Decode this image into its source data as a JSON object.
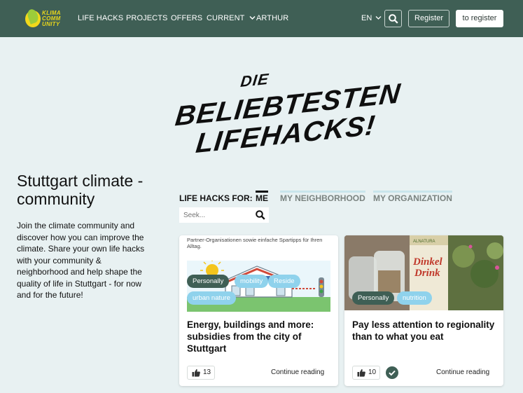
{
  "header": {
    "logo_text_line1": "KLIMA",
    "logo_text_line2": "COMM",
    "logo_text_line3": "UNITY",
    "nav": [
      "LIFE HACKS",
      "PROJECTS",
      "OFFERS",
      "CURRENT",
      "ARTHUR"
    ],
    "lang": "EN",
    "register": "Register",
    "to_register": "to register"
  },
  "hero": {
    "line1": "DIE",
    "line2": "BELIEBTESTEN",
    "line3": "LIFEHACKS!"
  },
  "left": {
    "title": "Stuttgart climate - community",
    "intro": "Join the climate community and discover how you can improve the climate. Share your own life hacks with your community & neighborhood and help shape the quality of life in Stuttgart - for now and for the future!"
  },
  "tabs": {
    "label": "LIFE HACKS FOR:",
    "items": [
      "ME",
      "MY NEIGHBORHOOD",
      "MY ORGANIZATION"
    ],
    "active": "ME"
  },
  "search": {
    "placeholder": "Seek..."
  },
  "cards": [
    {
      "snippet": "Partner-Organisationen sowie einfache Spartipps für Ihren Alltag.",
      "tags": [
        "Personally",
        "mobility",
        "Reside",
        "urban nature"
      ],
      "title": "Energy, buildings and more: subsidies from the city of Stuttgart",
      "likes": "13",
      "continue": "Continue reading"
    },
    {
      "tags": [
        "Personally",
        "nutrition"
      ],
      "title": "Pay less attention to regionality than to what you eat",
      "likes": "10",
      "continue": "Continue reading",
      "image_labels": [
        "Dinkel",
        "Drink",
        "ALNATURA"
      ]
    }
  ],
  "colors": {
    "header": "#3f5f55",
    "background": "#e8f1f2",
    "tag_dark": "#3f5f55",
    "tag_light": "#8fd2ec"
  }
}
